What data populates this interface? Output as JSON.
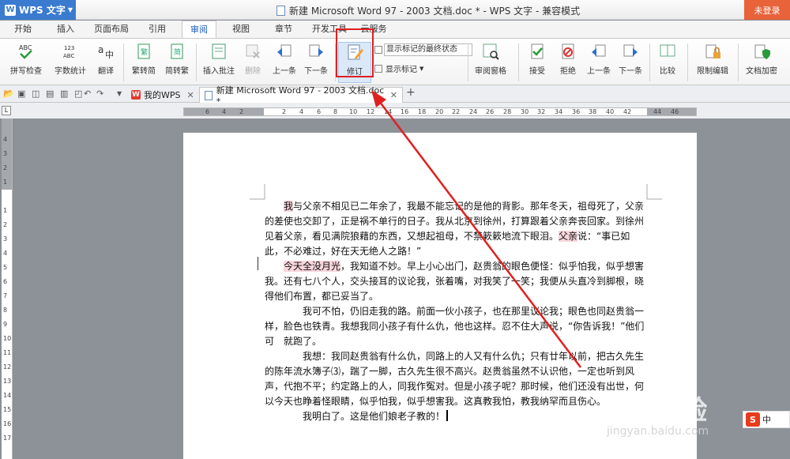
{
  "app": {
    "name": "WPS 文字",
    "logo": "W",
    "window_title": "新建 Microsoft Word 97 - 2003 文档.doc * - WPS 文字 - 兼容模式",
    "login": "未登录"
  },
  "menu": [
    "开始",
    "插入",
    "页面布局",
    "引用",
    "审阅",
    "视图",
    "章节",
    "开发工具",
    "云服务"
  ],
  "ribbon": {
    "spell_check": "拼写检查",
    "word_count": "字数统计",
    "translate": "翻译",
    "to_simplified": "繁转简",
    "to_traditional": "简转繁",
    "insert_comment": "插入批注",
    "delete": "删除",
    "prev": "上一条",
    "next": "下一条",
    "revise": "修订",
    "show_final_markup": "显示标记的最终状态",
    "show_markup": "显示标记",
    "review_pane": "审阅窗格",
    "accept": "接受",
    "reject": "拒绝",
    "prev2": "上一条",
    "next2": "下一条",
    "compare": "比较",
    "restrict_edit": "限制编辑",
    "doc_encrypt": "文档加密"
  },
  "tabs": {
    "my_wps": "我的WPS",
    "doc": "新建 Microsoft Word 97 - 2003 文档.doc *",
    "add": "+"
  },
  "ruler_h": [
    "6",
    "4",
    "2",
    "",
    "2",
    "4",
    "6",
    "8",
    "10",
    "12",
    "14",
    "16",
    "18",
    "20",
    "22",
    "24",
    "26",
    "28",
    "30",
    "32",
    "34",
    "36",
    "38",
    "40",
    "42",
    "44",
    "46"
  ],
  "ruler_v": [
    "4",
    "3",
    "2",
    "1",
    "",
    "1",
    "2",
    "3",
    "4",
    "5",
    "6",
    "7",
    "8",
    "9",
    "10",
    "11",
    "12",
    "13",
    "14",
    "15",
    "16",
    "17",
    "18",
    "19",
    "20"
  ],
  "document": {
    "p1_hl": "我",
    "p1_a": "与父亲不相见已二年余了，我最不能忘记的是他的背影。那年冬天，祖母死了，父亲的差使也交卸了，正是祸不单行的日子。我从北京到徐州，打算跟着父亲奔丧回家。到徐州见着父亲，看见满院狼藉的东西，又想起祖母，不禁簌簌地流下眼泪。",
    "p1_hl2": "父亲",
    "p1_b": "说：“事已如此，不必难过，好在天无绝人之路！”",
    "p2_hl": "今天全没月光",
    "p2_a": "，我知道不妙。早上小心出门，赵贵翁的眼色便怪：似乎怕我，似乎想害我。还有七八个人，交头接耳的议论我，张着嘴，对我笑了一笑；我便从头直冷到脚根，晓得他们布置，都已妥当了。",
    "p3": "我可不怕，仍旧走我的路。前面一伙小孩子，也在那里议论我；眼色也同赵贵翁一样，脸色也铁青。我想我同小孩子有什么仇，他也这样。忍不住大声说，“你告诉我！”他们可　就跑了。",
    "p4": "我想：我同赵贵翁有什么仇，同路上的人又有什么仇；只有廿年以前，把古久先生的陈年流水簿子⑶，踹了一脚，古久先生很不高兴。赵贵翁虽然不认识他，一定也听到风声，代抱不平；约定路上的人，同我作冤对。但是小孩子呢？那时候，他们还没有出世，何以今天也睁着怪眼睛，似乎怕我，似乎想害我。这真教我怕，教我纳罕而且伤心。",
    "p5": "我明白了。这是他们娘老子教的！"
  },
  "watermark": {
    "main": "Bai 经验",
    "sub": "jingyan.baidu.com"
  },
  "ime": {
    "logo": "S",
    "mode": "中"
  },
  "colors": {
    "accent": "#3a7bd0",
    "login": "#e8623a",
    "highlight": "#f7d6dc",
    "annotation": "#e02020"
  }
}
